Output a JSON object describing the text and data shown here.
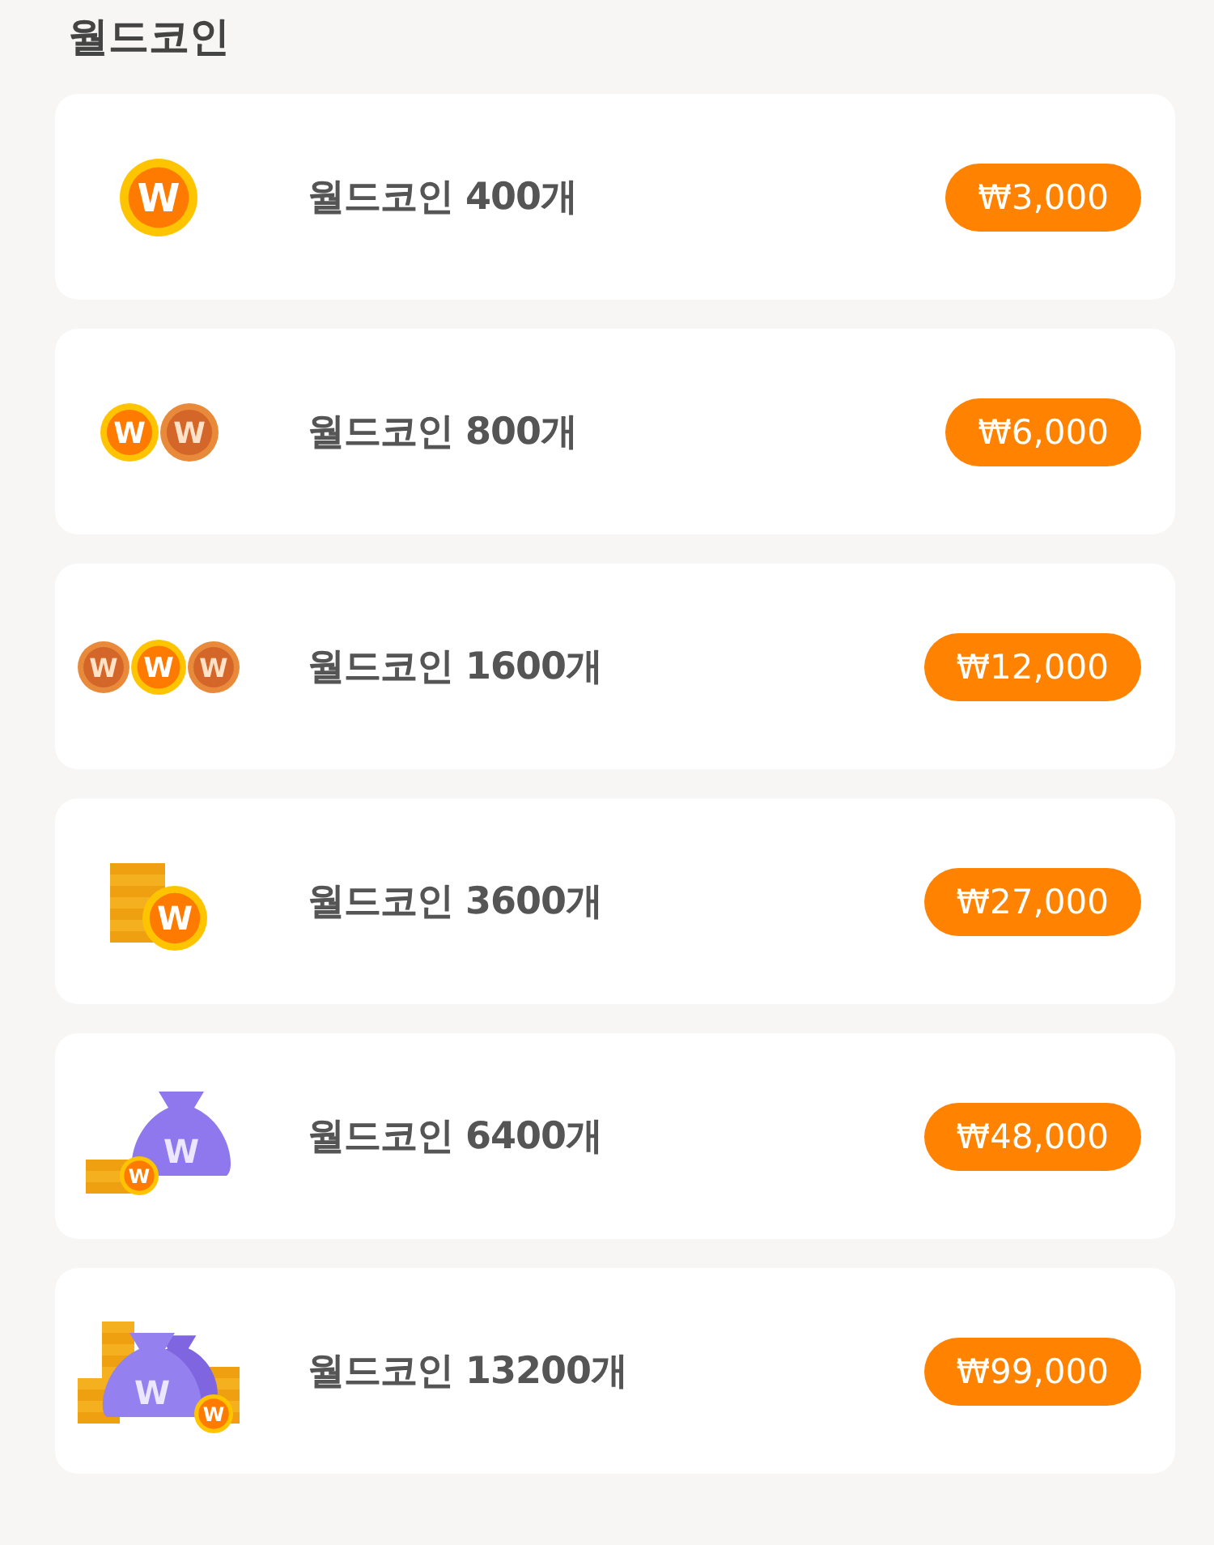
{
  "title": "월드코인",
  "products": [
    {
      "kind": "coin1",
      "coin_marks": [
        "W"
      ],
      "label": "월드코인 400개",
      "price": "₩3,000"
    },
    {
      "kind": "coin2",
      "coin_marks": [
        "W",
        "W"
      ],
      "label": "월드코인 800개",
      "price": "₩6,000"
    },
    {
      "kind": "coin3",
      "coin_marks": [
        "W",
        "W",
        "W"
      ],
      "label": "월드코인 1600개",
      "price": "₩12,000"
    },
    {
      "kind": "stack",
      "coin_marks": [
        "W"
      ],
      "label": "월드코인 3600개",
      "price": "₩27,000"
    },
    {
      "kind": "bag",
      "coin_marks": [
        "W",
        "W"
      ],
      "label": "월드코인 6400개",
      "price": "₩48,000"
    },
    {
      "kind": "bags",
      "coin_marks": [
        "W",
        "W"
      ],
      "label": "월드코인 13200개",
      "price": "₩99,000"
    }
  ]
}
